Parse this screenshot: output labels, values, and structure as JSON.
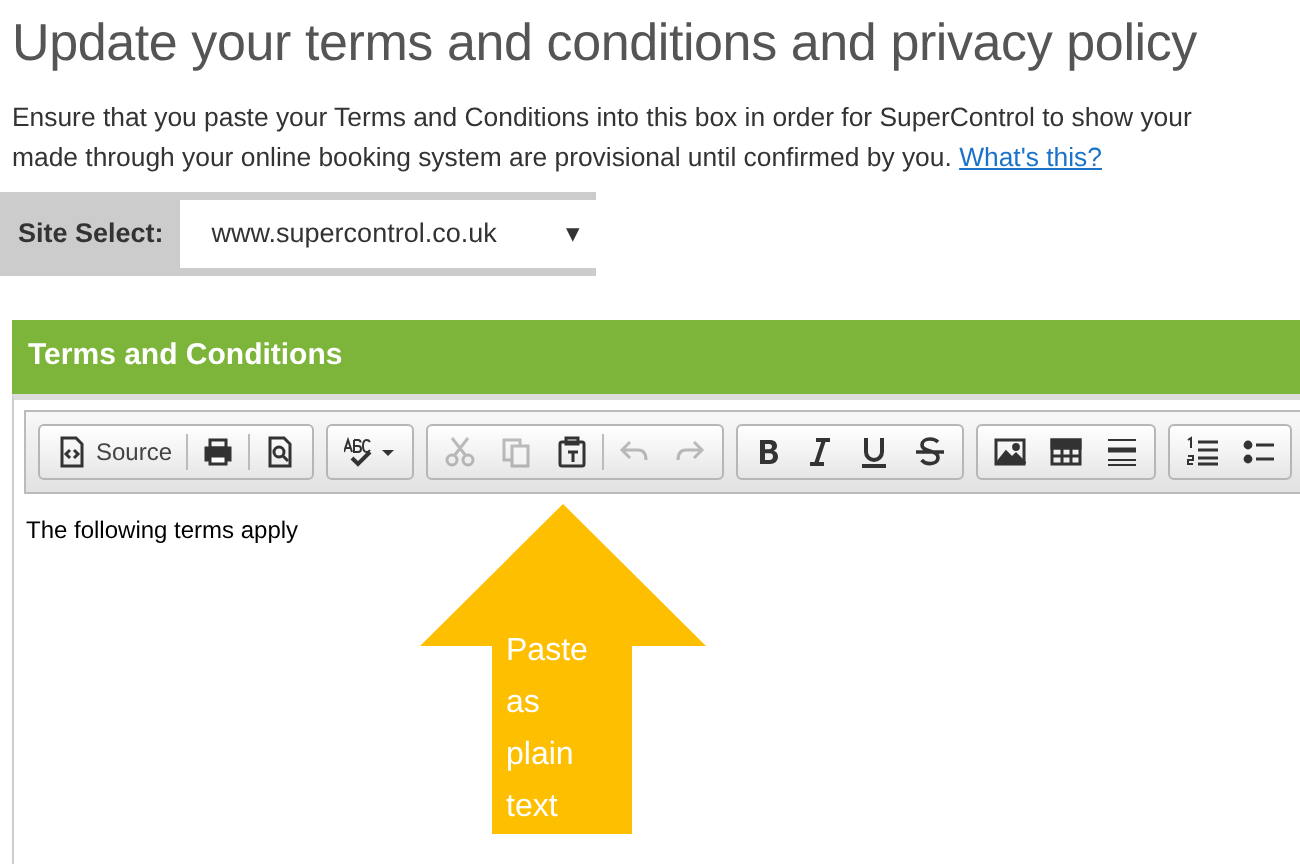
{
  "title": "Update your terms and conditions and privacy policy",
  "intro": {
    "lines": [
      "Ensure that you paste your Terms and Conditions into this box in order for SuperControl to show your",
      "made through your online booking system are provisional until confirmed by you."
    ],
    "link": "What's this?"
  },
  "site_select": {
    "label": "Site Select:",
    "value": "www.supercontrol.co.uk",
    "caret": "▾"
  },
  "panel": {
    "title": "Terms and Conditions"
  },
  "toolbar": [
    {
      "buttons": [
        {
          "label": "Source",
          "disabled": false
        },
        {
          "disabled": false
        },
        {
          "disabled": false
        }
      ]
    },
    {
      "buttons": [
        {
          "disabled": false
        }
      ]
    },
    {
      "buttons": [
        {
          "disabled": true
        },
        {
          "disabled": true
        },
        {
          "disabled": false
        },
        {
          "disabled": true
        },
        {
          "disabled": true
        }
      ]
    },
    {
      "buttons": [
        {
          "disabled": false
        },
        {
          "disabled": false
        },
        {
          "disabled": false
        },
        {
          "disabled": false
        }
      ]
    },
    {
      "buttons": [
        {
          "disabled": false
        },
        {
          "disabled": false
        },
        {
          "disabled": false
        }
      ]
    },
    {
      "buttons": [
        {
          "disabled": false
        },
        {
          "disabled": false
        }
      ]
    }
  ],
  "editor_text": "The following terms apply",
  "callout": {
    "text": "Paste as plain text"
  }
}
